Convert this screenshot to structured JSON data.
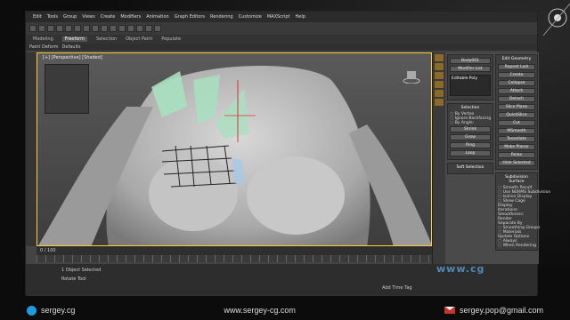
{
  "app": {
    "menu": [
      "Edit",
      "Tools",
      "Group",
      "Views",
      "Create",
      "Modifiers",
      "Animation",
      "Graph Editors",
      "Rendering",
      "Customize",
      "MAXScript",
      "Help"
    ],
    "ribbon_tabs": [
      "Modeling",
      "Freeform",
      "Selection",
      "Object Paint",
      "Populate"
    ],
    "sub_ribbon": [
      "Paint Deform",
      "Defaults"
    ],
    "viewport_label": "[+] [Perspective] [Shaded]"
  },
  "command_panel": {
    "object_name": "Body001",
    "modifier_list": "Modifier List",
    "stack_item": "Editable Poly",
    "selection_title": "Selection",
    "selection_options": [
      "By Vertex",
      "Ignore Backfacing",
      "By Angle:",
      "Shrink",
      "Grow",
      "Ring",
      "Loop"
    ],
    "soft_selection": "Soft Selection",
    "edit_geometry_title": "Edit Geometry",
    "edit_geometry_buttons": [
      "Repeat Last",
      "Create",
      "Collapse",
      "Attach",
      "Detach",
      "Slice Plane",
      "Split",
      "Slice",
      "Reset Plane",
      "QuickSlice",
      "Cut",
      "MSmooth",
      "Tessellate",
      "Make Planar",
      "View Align",
      "Grid Align",
      "Relax",
      "Hide Selected",
      "Unhide All",
      "Hide Unselected"
    ],
    "subdivision_title": "Subdivision Surface",
    "subdivision_options": [
      "Smooth Result",
      "Use NURMS Subdivision",
      "Isoline Display",
      "Show Cage"
    ],
    "display": "Display",
    "iterations_label": "Iterations:",
    "smoothness_label": "Smoothness:",
    "render": "Render",
    "separate_by": "Separate By",
    "smoothing_groups": "Smoothing Groups",
    "materials": "Materials",
    "update_options": "Update Options",
    "always": "Always",
    "when_rendering": "When Rendering"
  },
  "timeline": {
    "frame": "0 / 100"
  },
  "status": {
    "line1": "1 Object Selected",
    "line2": "Rotate Tool",
    "add_time_tag": "Add Time Tag"
  },
  "footer": {
    "skype": "sergey.cg",
    "website": "www.sergey-cg.com",
    "email": "sergey.pop@gmail.com"
  },
  "colors": {
    "skype_blue": "#1e9ce0",
    "mail_red": "#c8342d",
    "viewport_border": "#ffcc33",
    "uv_green": "#a8e0c0"
  }
}
